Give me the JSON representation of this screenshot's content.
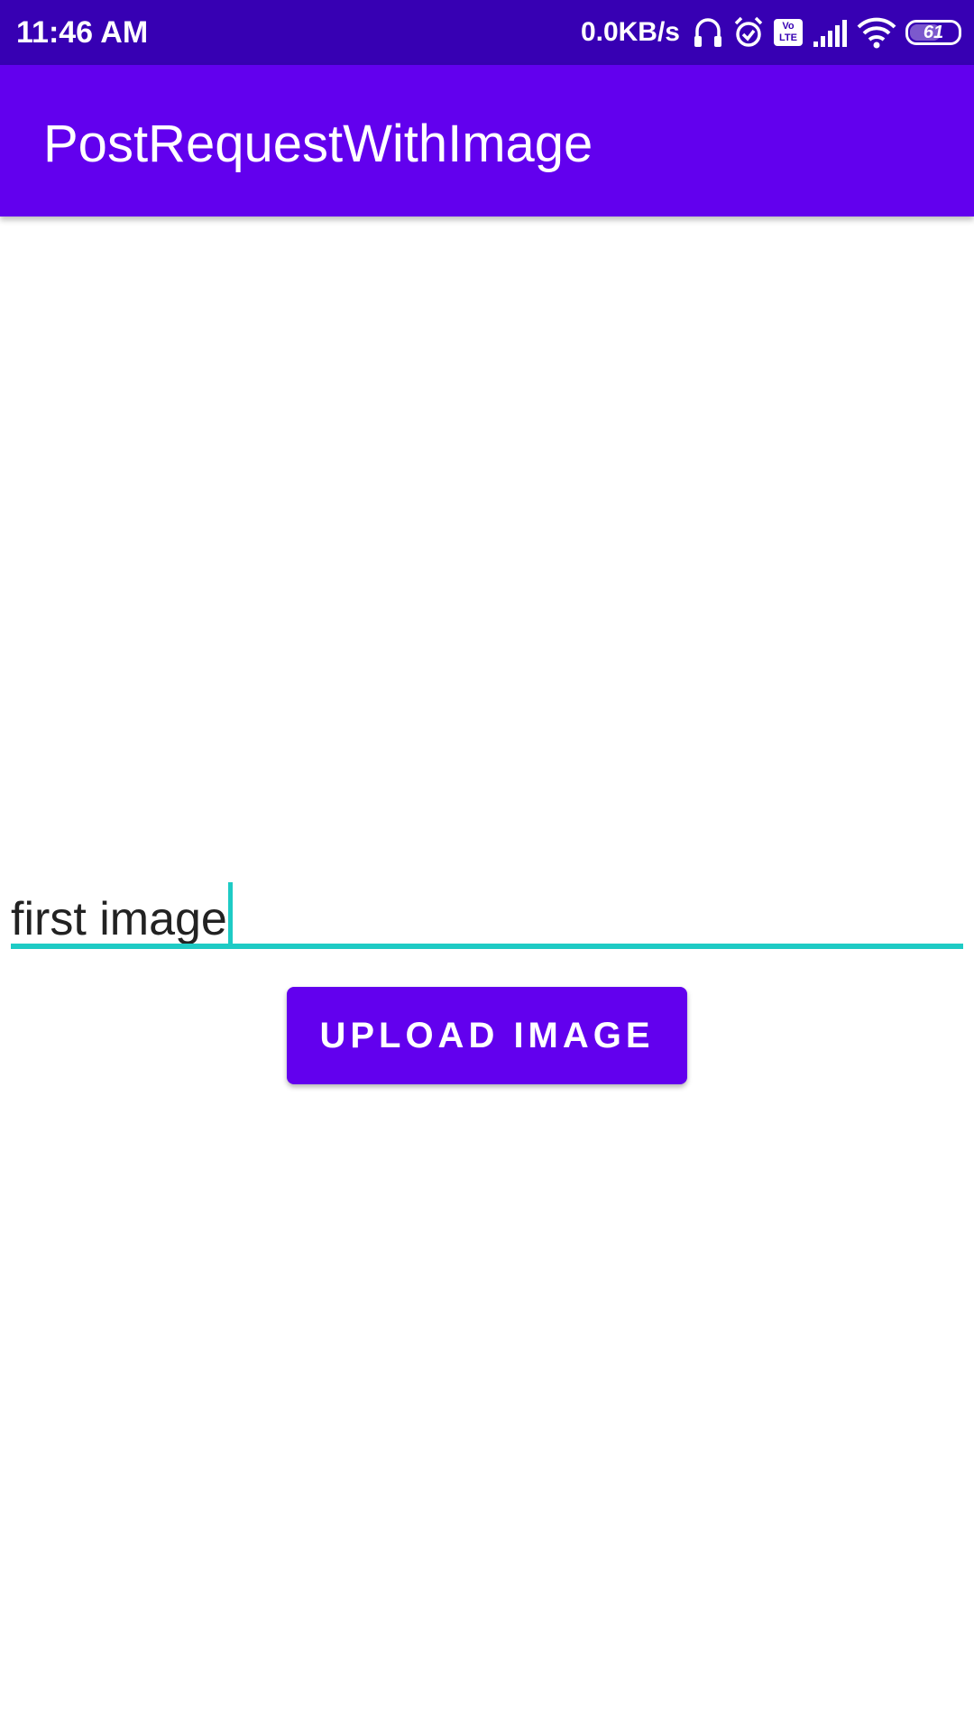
{
  "status_bar": {
    "time": "11:46 AM",
    "net_speed": "0.0KB/s",
    "icons": [
      "headphones-icon",
      "alarm-icon",
      "volte-icon",
      "cell-signal-icon",
      "wifi-icon",
      "battery-icon"
    ],
    "volte_label": "Vo LTE",
    "battery_level": "61",
    "background_color": "#3700b3"
  },
  "app_bar": {
    "title": "PostRequestWithImage",
    "background_color": "#6200ee"
  },
  "form": {
    "image_name_value": "first image",
    "accent_color": "#1ecbc5",
    "upload_button_label": "UPLOAD IMAGE"
  }
}
